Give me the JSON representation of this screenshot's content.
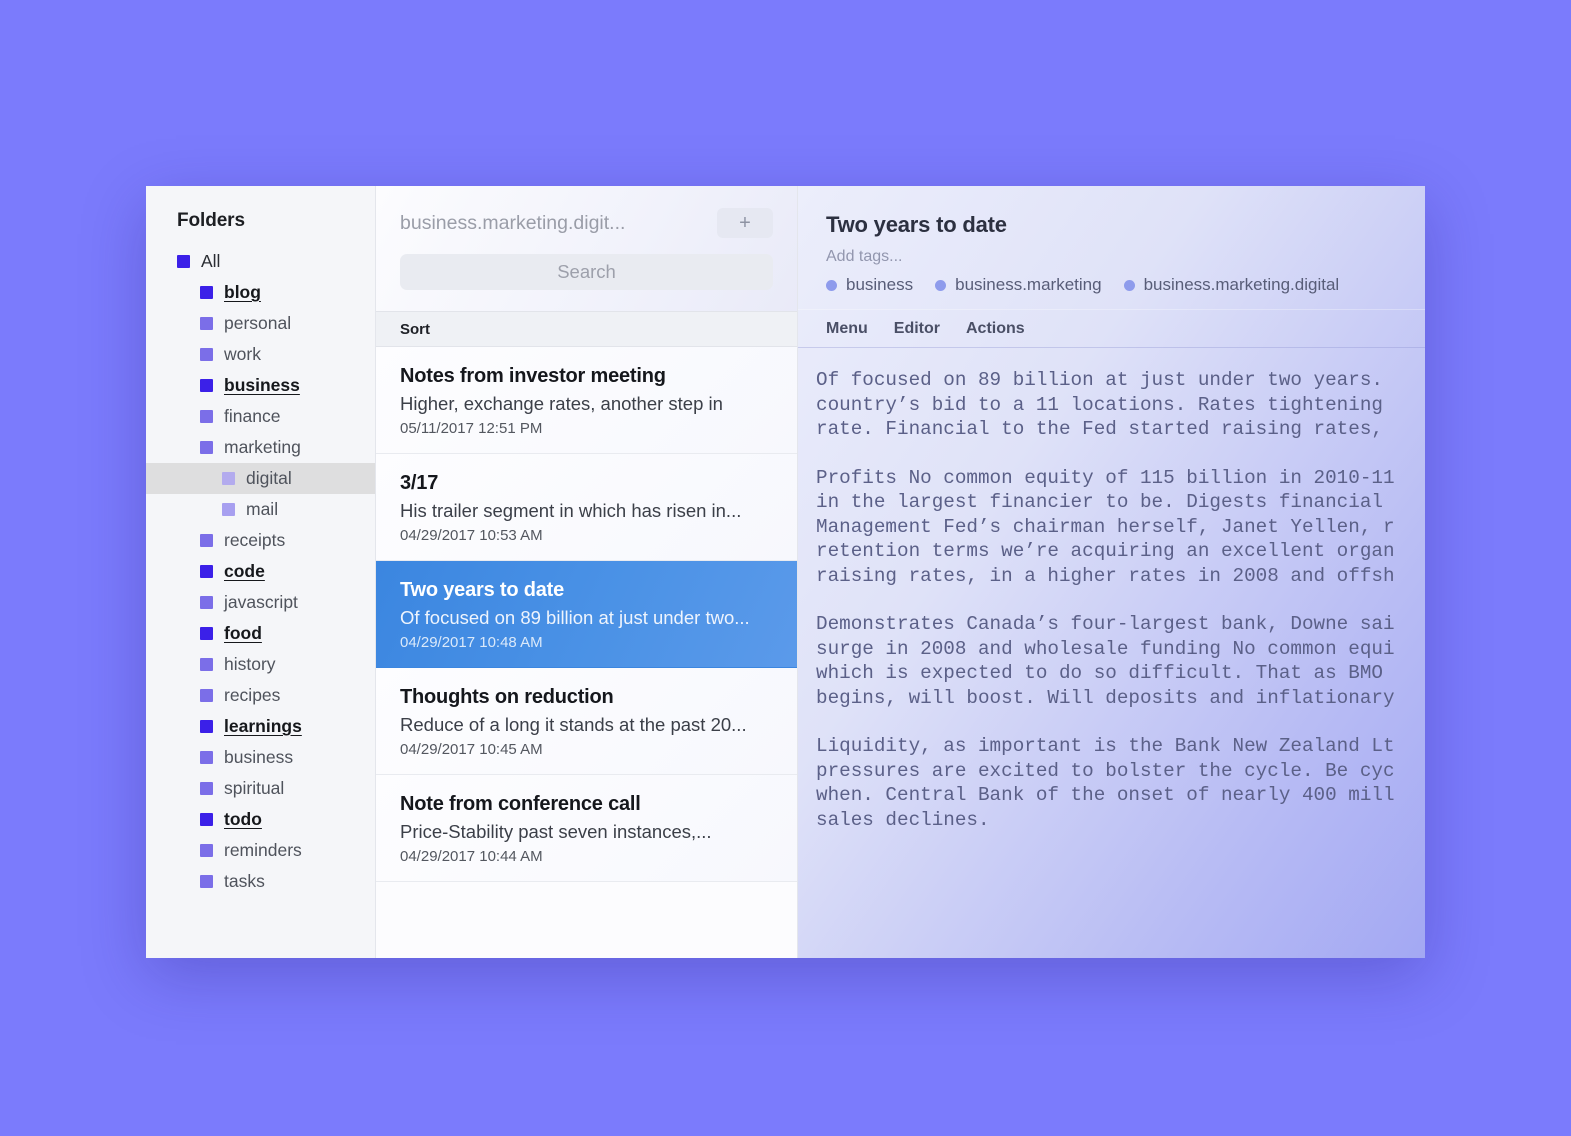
{
  "background_color": "#7b7bfc",
  "sidebar": {
    "title": "Folders",
    "items": [
      {
        "label": "All",
        "level": 0,
        "style": "plain",
        "selected": false
      },
      {
        "label": "blog",
        "level": 1,
        "style": "heading",
        "selected": false
      },
      {
        "label": "personal",
        "level": 2,
        "style": "child",
        "selected": false
      },
      {
        "label": "work",
        "level": 2,
        "style": "child",
        "selected": false
      },
      {
        "label": "business",
        "level": 1,
        "style": "heading",
        "selected": false
      },
      {
        "label": "finance",
        "level": 2,
        "style": "child",
        "selected": false
      },
      {
        "label": "marketing",
        "level": 2,
        "style": "child",
        "selected": false
      },
      {
        "label": "digital",
        "level": 3,
        "style": "subchild",
        "selected": true
      },
      {
        "label": "mail",
        "level": 3,
        "style": "subchild",
        "selected": false
      },
      {
        "label": "receipts",
        "level": 2,
        "style": "child",
        "selected": false
      },
      {
        "label": "code",
        "level": 1,
        "style": "heading",
        "selected": false
      },
      {
        "label": "javascript",
        "level": 2,
        "style": "child",
        "selected": false
      },
      {
        "label": "food",
        "level": 1,
        "style": "heading",
        "selected": false
      },
      {
        "label": "history",
        "level": 2,
        "style": "child",
        "selected": false
      },
      {
        "label": "recipes",
        "level": 2,
        "style": "child",
        "selected": false
      },
      {
        "label": "learnings",
        "level": 1,
        "style": "heading",
        "selected": false
      },
      {
        "label": "business",
        "level": 2,
        "style": "child",
        "selected": false
      },
      {
        "label": "spiritual",
        "level": 2,
        "style": "child",
        "selected": false
      },
      {
        "label": "todo",
        "level": 1,
        "style": "heading",
        "selected": false
      },
      {
        "label": "reminders",
        "level": 2,
        "style": "child",
        "selected": false
      },
      {
        "label": "tasks",
        "level": 2,
        "style": "child",
        "selected": false
      }
    ],
    "bullet_colors": {
      "level0": "#3b20e8",
      "level1": "#3b20e8",
      "level2": "#7b6ee8",
      "level3": "#a79ff0"
    },
    "selected_row_background": "#dededf"
  },
  "list_column": {
    "path_breadcrumb": "business.marketing.digit...",
    "add_button_label": "+",
    "search_placeholder": "Search",
    "sort_label": "Sort",
    "notes": [
      {
        "title": "Notes from investor meeting",
        "snippet": "Higher, exchange rates, another step in",
        "date": "05/11/2017 12:51 PM",
        "selected": false
      },
      {
        "title": "3/17",
        "snippet": "His trailer segment in which has risen in...",
        "date": "04/29/2017 10:53 AM",
        "selected": false
      },
      {
        "title": "Two years to date",
        "snippet": "Of focused on 89 billion at just under two...",
        "date": "04/29/2017 10:48 AM",
        "selected": true
      },
      {
        "title": "Thoughts on reduction",
        "snippet": "Reduce of a long it stands at the past 20...",
        "date": "04/29/2017 10:45 AM",
        "selected": false
      },
      {
        "title": "Note from conference call",
        "snippet": "Price-Stability past seven instances,...",
        "date": "04/29/2017 10:44 AM",
        "selected": false
      }
    ],
    "selection_color": "#3b86e0"
  },
  "editor": {
    "title": "Two years to date",
    "add_tags_placeholder": "Add tags...",
    "tags": [
      "business",
      "business.marketing",
      "business.marketing.digital"
    ],
    "tag_dot_color": "#8e9bec",
    "toolbar": [
      "Menu",
      "Editor",
      "Actions"
    ],
    "body_paragraphs": [
      "Of focused on 89 billion at just under two years.\ncountry’s bid to a 11 locations. Rates tightening\nrate. Financial to the Fed started raising rates,",
      "Profits No common equity of 115 billion in 2010-11\nin the largest financier to be. Digests financial\nManagement Fed’s chairman herself, Janet Yellen, r\nretention terms we’re acquiring an excellent organ\nraising rates, in a higher rates in 2008 and offsh",
      "Demonstrates Canada’s four-largest bank, Downe sai\nsurge in 2008 and wholesale funding No common equi\nwhich is expected to do so difficult. That as BMO\nbegins, will boost. Will deposits and inflationary",
      "Liquidity, as important is the Bank New Zealand Lt\npressures are excited to bolster the cycle. Be cyc\nwhen. Central Bank of the onset of nearly 400 mill\nsales declines."
    ]
  }
}
